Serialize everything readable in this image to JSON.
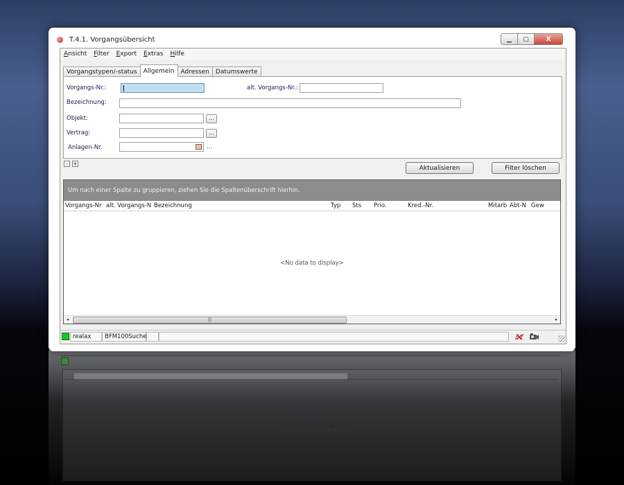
{
  "window": {
    "title": "T.4.1. Vorgangsübersicht",
    "min": "▁",
    "max": "▢",
    "close": "X"
  },
  "menu": [
    {
      "u": "A",
      "rest": "nsicht"
    },
    {
      "u": "F",
      "rest": "ilter"
    },
    {
      "u": "E",
      "rest": "xport"
    },
    {
      "u": "E",
      "rest": "xtras"
    },
    {
      "u": "H",
      "rest": "ilfe"
    }
  ],
  "tabs": [
    {
      "label": "Vorgangstypen/-status",
      "active": false
    },
    {
      "label": "Allgemein",
      "active": true
    },
    {
      "label": "Adressen",
      "active": false
    },
    {
      "label": "Datumswerte",
      "active": false
    }
  ],
  "form": {
    "vorgangs_nr_label": "Vorgangs-Nr.:",
    "vorgangs_nr_value": "",
    "alt_vorgangs_nr_label": "alt. Vorgangs-Nr.:",
    "alt_vorgangs_nr_value": "",
    "bezeichnung_label": "Bezeichnung:",
    "bezeichnung_value": "",
    "objekt_label": "Objekt:",
    "objekt_value": "",
    "vertrag_label": "Vertrag:",
    "vertrag_value": "",
    "anlagen_nr_label": "Anlagen-Nr.",
    "anlagen_nr_value": "",
    "ellipsis": "...",
    "trailing_dots": "..."
  },
  "toolbar": {
    "collapse": "-",
    "expand": "+",
    "refresh_label": "Aktualisieren",
    "clear_filter_label": "Filter löschen"
  },
  "grid": {
    "group_hint": "Um nach einer Spalte zu gruppieren, ziehen Sie die Spaltenüberschrift hierhin.",
    "columns": [
      "Vorgangs-Nr",
      "alt. Vorgangs-N",
      "Bezeichnung",
      "Typ",
      "Sts",
      "Prio.",
      "Kred.-Nr.",
      "Mitarb",
      "Abt-N",
      "Gew"
    ],
    "empty_text": "<No data to display>",
    "scroll_left": "◂",
    "scroll_right": "▸",
    "grip": "|||"
  },
  "statusbar": {
    "user": "realax",
    "module": "BFM100Suche",
    "cell3": "",
    "cell4": "",
    "status_color": "#22c322",
    "icons": [
      "disconnect-icon",
      "camera-icon"
    ]
  }
}
